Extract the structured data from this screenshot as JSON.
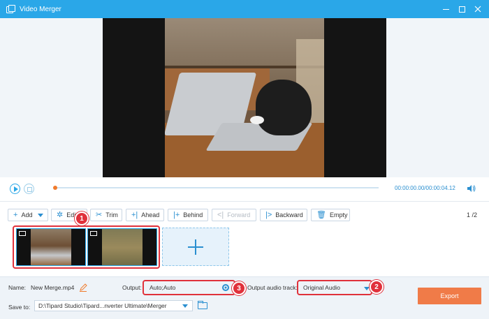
{
  "window": {
    "title": "Video Merger",
    "accent": "#2aa7e8"
  },
  "player": {
    "time_current": "00:00:00.00",
    "time_total": "00:00:04.12",
    "progress": 0
  },
  "toolbar": {
    "add": "Add",
    "edit": "Edit",
    "trim": "Trim",
    "ahead": "Ahead",
    "behind": "Behind",
    "forward": "Forward",
    "backward": "Backward",
    "empty": "Empty"
  },
  "pager": {
    "current": "1",
    "sep": "/",
    "total": "2"
  },
  "clips": [
    {
      "type": "film-icon"
    },
    {
      "type": "film-icon"
    }
  ],
  "badges": {
    "one": "1",
    "two": "2",
    "three": "3",
    "color": "#e0313b"
  },
  "settings": {
    "name_label": "Name:",
    "name_value": "New Merge.mp4",
    "output_label": "Output:",
    "output_value": "Auto;Auto",
    "audio_label": "Output audio track:",
    "audio_value": "Original Audio",
    "save_label": "Save to:",
    "save_value": "D:\\Tipard Studio\\Tipard...nverter Ultimate\\Merger",
    "export": "Export",
    "export_color": "#f07b48"
  }
}
